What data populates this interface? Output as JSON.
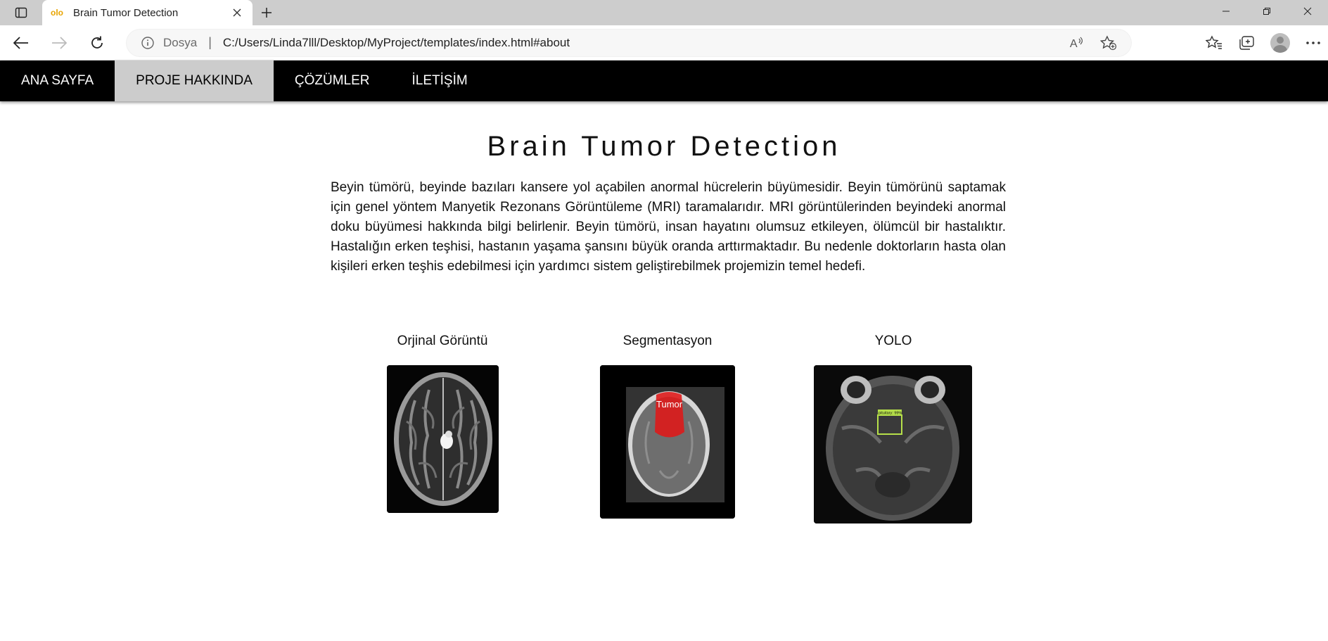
{
  "browser": {
    "tab_title": "Brain Tumor Detection",
    "favicon_text": "olo",
    "url_scheme": "Dosya",
    "url": "C:/Users/Linda7lll/Desktop/MyProject/templates/index.html#about"
  },
  "nav": {
    "items": [
      {
        "label": "ANA SAYFA"
      },
      {
        "label": "PROJE HAKKINDA"
      },
      {
        "label": "ÇÖZÜMLER"
      },
      {
        "label": "İLETİŞİM"
      }
    ],
    "active_index": 1
  },
  "content": {
    "title": "Brain Tumor Detection",
    "paragraph": "Beyin tümörü, beyinde bazıları kansere yol açabilen anormal hücrelerin büyümesidir. Beyin tümörünü saptamak için genel yöntem Manyetik Rezonans Görüntüleme (MRI) taramalarıdır. MRI görüntülerinden beyindeki anormal doku büyümesi hakkında bilgi belirlenir. Beyin tümörü, insan hayatını olumsuz etkileyen, ölümcül bir hastalıktır. Hastalığın erken teşhisi, hastanın yaşama şansını büyük oranda arttırmaktadır. Bu nedenle doktorların hasta olan kişileri erken teşhis edebilmesi için yardımcı sistem geliştirebilmek projemizin temel hedefi."
  },
  "figures": {
    "original_caption": "Orjinal Görüntü",
    "segmentation_caption": "Segmentasyon",
    "segmentation_label": "Tumor",
    "yolo_caption": "YOLO",
    "yolo_label": "pituitary: 99%"
  },
  "colors": {
    "navbar_bg": "#000000",
    "nav_active_bg": "#cccccc",
    "tumor_mask": "#e01818",
    "yolo_box": "#b6e04a"
  }
}
